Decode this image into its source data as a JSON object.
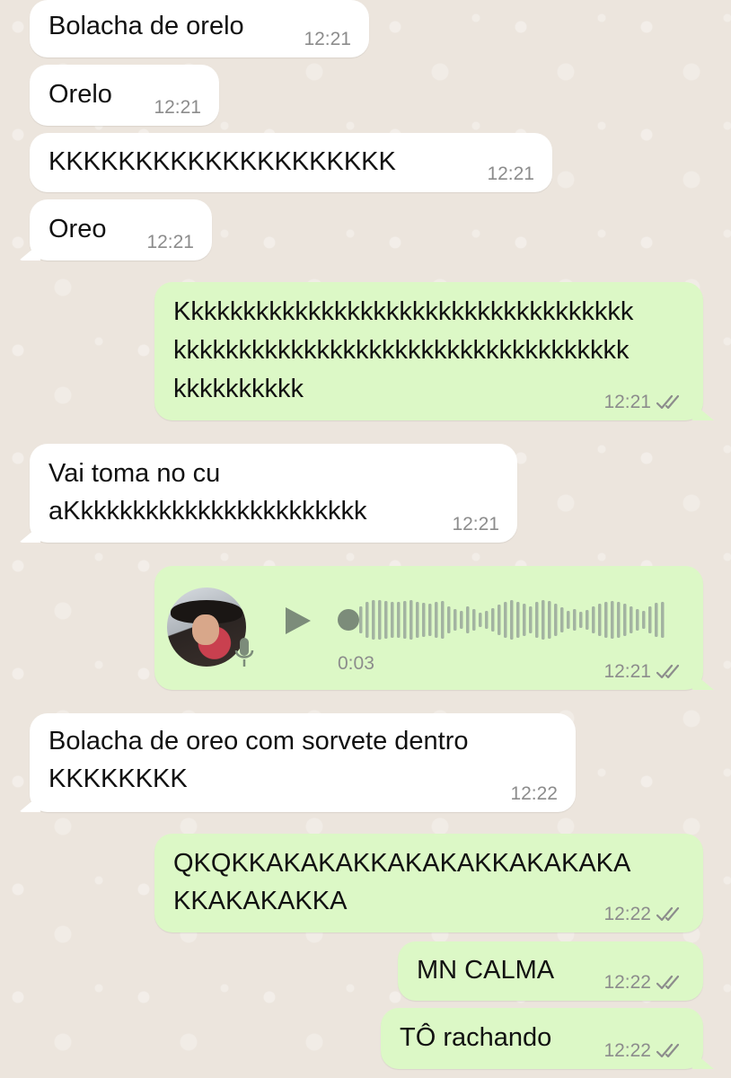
{
  "conversation": {
    "messages": [
      {
        "direction": "in",
        "lines": [
          "Bolacha de orelo"
        ],
        "time": "12:21"
      },
      {
        "direction": "in",
        "lines": [
          "Orelo"
        ],
        "time": "12:21"
      },
      {
        "direction": "in",
        "lines": [
          "KKKKKKKKKKKKKKKKKKKK"
        ],
        "time": "12:21"
      },
      {
        "direction": "in",
        "lines": [
          "Oreo"
        ],
        "time": "12:21"
      },
      {
        "direction": "out",
        "lines": [
          "Kkkkkkkkkkkkkkkkkkkkkkkkkkkkkkkkkkk",
          "kkkkkkkkkkkkkkkkkkkkkkkkkkkkkkkkkkk",
          "kkkkkkkkkk"
        ],
        "time": "12:21",
        "read": true
      },
      {
        "direction": "in",
        "lines": [
          "Vai toma no cu",
          "aKkkkkkkkkkkkkkkkkkkkkkk"
        ],
        "time": "12:21"
      },
      {
        "direction": "out",
        "type": "voice",
        "duration": "0:03",
        "time": "12:21",
        "read": true,
        "played_fraction": 0
      },
      {
        "direction": "in",
        "lines": [
          "Bolacha de oreo com sorvete dentro",
          "KKKKKKKK"
        ],
        "time": "12:22"
      },
      {
        "direction": "out",
        "lines": [
          "QKQKKAKAKAKKAKAKAKKAKAKAKA",
          "KKAKAKAKKA"
        ],
        "time": "12:22",
        "read": true
      },
      {
        "direction": "out",
        "lines": [
          "MN CALMA"
        ],
        "time": "12:22",
        "read": true
      },
      {
        "direction": "out",
        "lines": [
          "TÔ rachando"
        ],
        "time": "12:22",
        "read": true
      }
    ]
  },
  "icons": {
    "play": "play-icon",
    "mic": "microphone-icon",
    "read_receipt": "double-check-icon"
  },
  "colors": {
    "background": "#ECE5DD",
    "incoming_bubble": "#FFFFFF",
    "outgoing_bubble": "#DCF8C6",
    "timestamp": "#8C8C8C",
    "waveform": "#A3B3A1",
    "play": "#7C8C7A"
  }
}
